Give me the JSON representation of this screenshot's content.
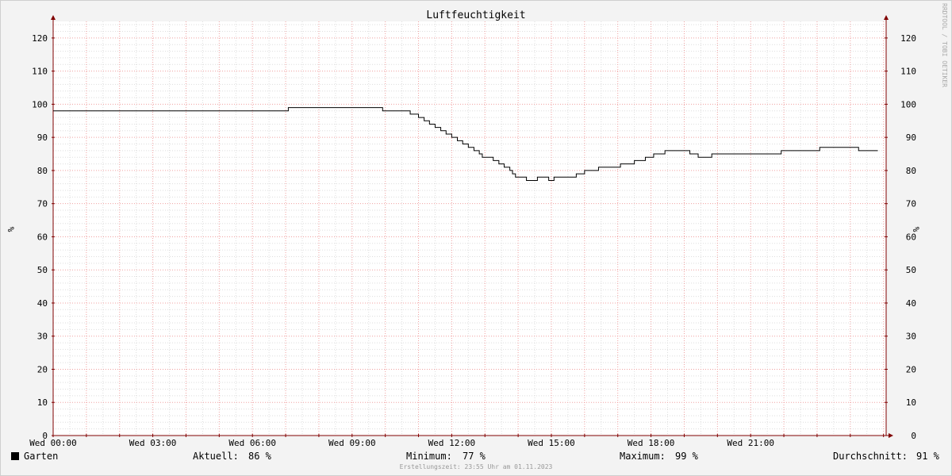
{
  "chart_data": {
    "type": "line",
    "title": "Luftfeuchtigkeit",
    "ylabel": "%",
    "ylim": [
      0,
      125
    ],
    "y_ticks": [
      0,
      10,
      20,
      30,
      40,
      50,
      60,
      70,
      80,
      90,
      100,
      110,
      120
    ],
    "x_range_hours": [
      0,
      24
    ],
    "x_ticks": [
      "Wed 00:00",
      "Wed 03:00",
      "Wed 06:00",
      "Wed 09:00",
      "Wed 12:00",
      "Wed 15:00",
      "Wed 18:00",
      "Wed 21:00"
    ],
    "series": [
      {
        "name": "Garten",
        "color": "#000000",
        "step": true,
        "points": [
          [
            0,
            98
          ],
          [
            7.08,
            99
          ],
          [
            9.92,
            98
          ],
          [
            10.75,
            97
          ],
          [
            11,
            96
          ],
          [
            11.17,
            95
          ],
          [
            11.33,
            94
          ],
          [
            11.5,
            93
          ],
          [
            11.67,
            92
          ],
          [
            11.83,
            91
          ],
          [
            12,
            90
          ],
          [
            12.17,
            89
          ],
          [
            12.33,
            88
          ],
          [
            12.5,
            87
          ],
          [
            12.67,
            86
          ],
          [
            12.83,
            85
          ],
          [
            12.92,
            84
          ],
          [
            13.25,
            83
          ],
          [
            13.42,
            82
          ],
          [
            13.58,
            81
          ],
          [
            13.75,
            80
          ],
          [
            13.83,
            79
          ],
          [
            13.92,
            78
          ],
          [
            14.25,
            77
          ],
          [
            14.58,
            78
          ],
          [
            14.92,
            77
          ],
          [
            15.08,
            78
          ],
          [
            15.75,
            79
          ],
          [
            16,
            80
          ],
          [
            16.42,
            81
          ],
          [
            17.08,
            82
          ],
          [
            17.5,
            83
          ],
          [
            17.83,
            84
          ],
          [
            18.08,
            85
          ],
          [
            18.42,
            86
          ],
          [
            19.17,
            85
          ],
          [
            19.42,
            84
          ],
          [
            19.83,
            85
          ],
          [
            21.92,
            86
          ],
          [
            23.08,
            87
          ],
          [
            24.25,
            86
          ],
          [
            24.83,
            86
          ]
        ]
      }
    ]
  },
  "legend": {
    "series_name": "Garten",
    "current_label": "Aktuell:",
    "current_value": "86 %",
    "min_label": "Minimum:",
    "min_value": "77 %",
    "max_label": "Maximum:",
    "max_value": "99 %",
    "avg_label": "Durchschnitt:",
    "avg_value": "91 %"
  },
  "footer": "Erstellungszeit: 23:55 Uhr am 01.11.2023",
  "watermark": "RRDTOOL / TOBI OETIKER",
  "colors": {
    "background": "#f3f3f3",
    "plot": "#ffffff",
    "major_grid": "#f0a0a0",
    "minor_grid": "#dddddd",
    "axis": "#800000",
    "line": "#000000"
  }
}
